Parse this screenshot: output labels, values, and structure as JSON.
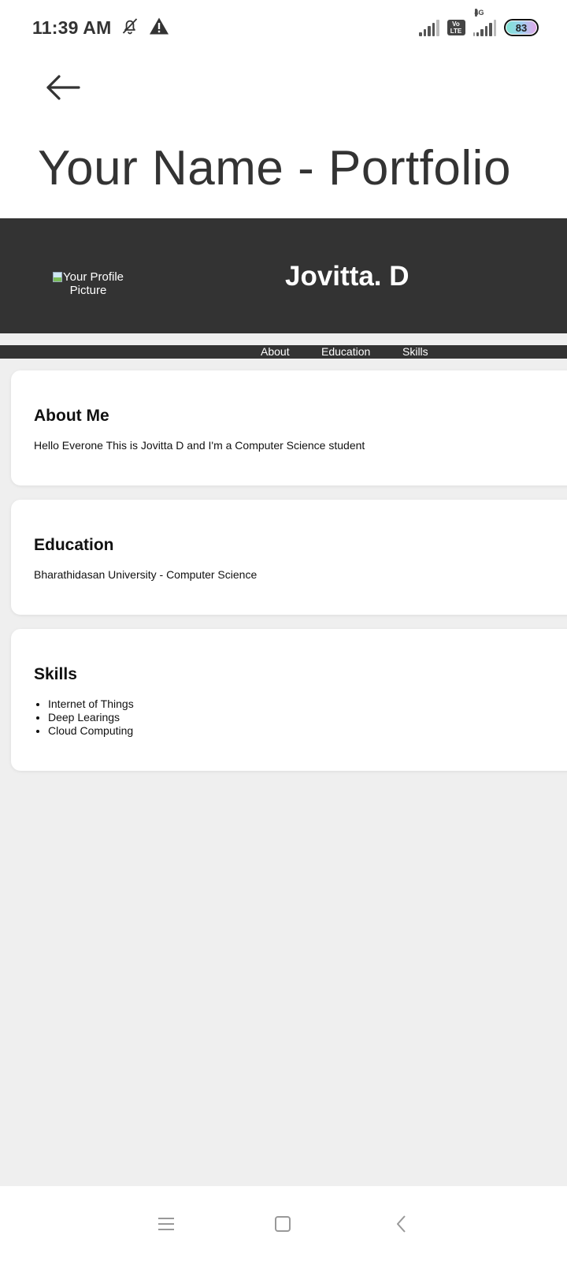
{
  "status_bar": {
    "time": "11:39 AM",
    "battery_level": "83",
    "network_type": "4G",
    "volte_label_top": "Vo",
    "volte_label_bottom": "LTE",
    "icons": [
      "bell-off-icon",
      "warning-icon",
      "signal-icon",
      "volte-icon",
      "signal-4g-icon",
      "battery-icon"
    ]
  },
  "app_bar": {
    "back_icon": "arrow-left-icon",
    "title": "Your Name - Portfolio"
  },
  "site": {
    "profile_image_alt": "Your Profile Picture",
    "name": "Jovitta. D",
    "nav": [
      "About",
      "Education",
      "Skills"
    ],
    "sections": {
      "about": {
        "heading": "About Me",
        "text": "Hello Everone This is Jovitta D and I'm a Computer Science student"
      },
      "education": {
        "heading": "Education",
        "text": "Bharathidasan University - Computer Science"
      },
      "skills": {
        "heading": "Skills",
        "items": [
          "Internet of Things",
          "Deep Learings",
          "Cloud Computing"
        ]
      }
    },
    "colors": {
      "header_bg": "#333333",
      "page_bg": "#efefef",
      "card_bg": "#ffffff"
    }
  },
  "system_nav": {
    "icons": [
      "menu-icon",
      "home-icon",
      "back-icon"
    ]
  }
}
